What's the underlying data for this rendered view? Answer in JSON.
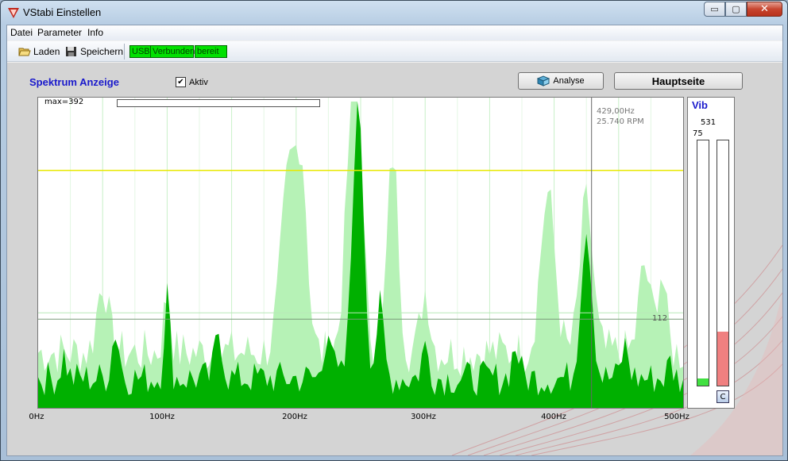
{
  "window": {
    "title": "VStabi Einstellen",
    "minimize": "▭",
    "maximize": "▢",
    "close": "✕"
  },
  "menu": [
    "Datei",
    "Parameter",
    "Info"
  ],
  "toolbar": {
    "load": "Laden",
    "save": "Speichern",
    "usb": "USB",
    "connected": "Verbunden",
    "ready": "bereit"
  },
  "main": {
    "heading": "Spektrum Anzeige",
    "aktiv_label": "Aktiv",
    "aktiv_checked": true,
    "analyse_button": "Analyse",
    "home_button": "Hauptseite"
  },
  "spectrum": {
    "max_label": "max=392",
    "cursor_freq": "429,00Hz",
    "cursor_rpm": "25.740 RPM",
    "threshold_label": "112",
    "x_ticks": [
      "0Hz",
      "100Hz",
      "200Hz",
      "300Hz",
      "400Hz",
      "500Hz"
    ],
    "x_range": [
      0,
      500
    ],
    "y_max": 392,
    "cursor_hz": 429,
    "threshold": 112,
    "yellow_line": 300,
    "colors": {
      "current": "#00b000",
      "peak": "#b6f2b6",
      "grid": "#c8f0c8",
      "yellow": "#e8e800"
    }
  },
  "vib": {
    "title": "Vib",
    "value_top": "531",
    "value_left": "75",
    "bar_left_fraction": 0.03,
    "bar_right_fraction": 0.22,
    "clear_button": "C",
    "colors": {
      "left": "#40e040",
      "right": "#f08080"
    }
  }
}
